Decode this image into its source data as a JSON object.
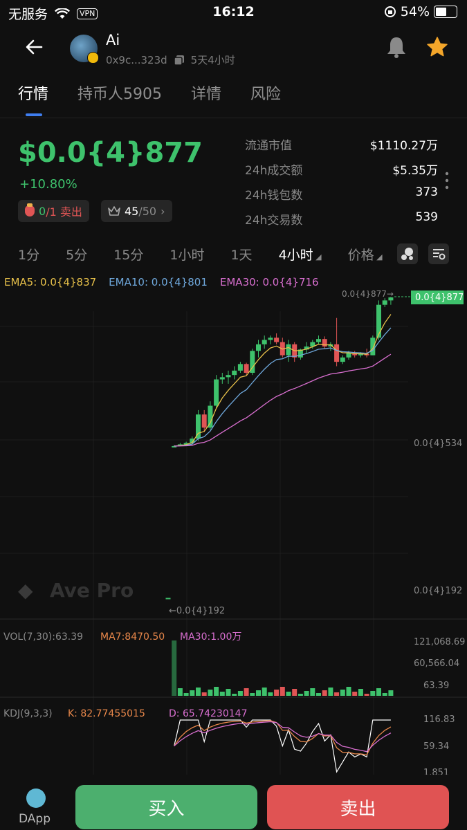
{
  "status_bar": {
    "carrier": "无服务",
    "vpn": "VPN",
    "time": "16:12",
    "battery": "54%"
  },
  "header": {
    "token_name": "Ai",
    "address": "0x9c...323d",
    "age": "5天4小时"
  },
  "tabs": [
    {
      "label": "行情",
      "active": true
    },
    {
      "label": "持币人5905",
      "active": false
    },
    {
      "label": "详情",
      "active": false
    },
    {
      "label": "风险",
      "active": false
    }
  ],
  "price": {
    "value": "$0.0{4}877",
    "change": "+10.80%",
    "tax_label": "0/1 卖出",
    "tax_prefix": "0",
    "tax_suffix": "/1 卖出",
    "score": "45",
    "score_total": "/50"
  },
  "stats": [
    {
      "label": "流通市值",
      "value": "$1110.27万"
    },
    {
      "label": "24h成交额",
      "value": "$5.35万"
    },
    {
      "label": "24h钱包数",
      "value": "373"
    },
    {
      "label": "24h交易数",
      "value": "539"
    }
  ],
  "timeframes": [
    {
      "label": "1分",
      "active": false
    },
    {
      "label": "5分",
      "active": false
    },
    {
      "label": "15分",
      "active": false
    },
    {
      "label": "1小时",
      "active": false
    },
    {
      "label": "1天",
      "active": false
    },
    {
      "label": "4小时",
      "active": true
    },
    {
      "label": "价格",
      "active": false
    }
  ],
  "ema": {
    "ema5": "EMA5: 0.0{4}837",
    "ema10": "EMA10: 0.0{4}801",
    "ema30": "EMA30: 0.0{4}716"
  },
  "chart_labels": {
    "current_price_tag": "0.0{4}877",
    "high_marker": "0.0{4}877→",
    "low_marker": "←0.0{4}192",
    "axis_mid": "0.0{4}534",
    "axis_low": "0.0{4}192",
    "watermark": "Ave Pro"
  },
  "volume": {
    "label": "VOL(7,30):63.39",
    "ma7": "MA7:8470.50",
    "ma30": "MA30:1.00万",
    "axis": [
      "121,068.69",
      "60,566.04",
      "63.39"
    ]
  },
  "kdj": {
    "label": "KDJ(9,3,3)",
    "k": "K: 82.77455015",
    "d": "D: 65.74230147",
    "axis": [
      "116.83",
      "59.34",
      "1.851"
    ]
  },
  "bottom": {
    "dapp": "DApp",
    "buy": "买入",
    "sell": "卖出"
  },
  "colors": {
    "up": "#3ec26c",
    "down": "#e05555",
    "ema5": "#e8c14a",
    "ema10": "#6fa8dc",
    "ema30": "#d96fd0"
  },
  "chart_data": {
    "type": "candlestick",
    "x_unit": "4h candle index",
    "ohlc": [
      [
        192,
        192,
        192,
        192
      ],
      [
        535,
        540,
        535,
        538
      ],
      [
        538,
        545,
        538,
        542
      ],
      [
        542,
        548,
        538,
        545
      ],
      [
        545,
        560,
        540,
        555
      ],
      [
        555,
        620,
        550,
        610
      ],
      [
        610,
        620,
        570,
        580
      ],
      [
        580,
        640,
        575,
        630
      ],
      [
        630,
        700,
        625,
        690
      ],
      [
        690,
        705,
        680,
        695
      ],
      [
        695,
        710,
        680,
        700
      ],
      [
        700,
        720,
        690,
        710
      ],
      [
        710,
        730,
        705,
        725
      ],
      [
        725,
        728,
        700,
        705
      ],
      [
        705,
        760,
        700,
        755
      ],
      [
        755,
        780,
        740,
        770
      ],
      [
        770,
        790,
        760,
        780
      ],
      [
        780,
        790,
        770,
        785
      ],
      [
        785,
        795,
        770,
        775
      ],
      [
        775,
        785,
        740,
        745
      ],
      [
        745,
        780,
        730,
        770
      ],
      [
        770,
        775,
        730,
        740
      ],
      [
        740,
        760,
        735,
        758
      ],
      [
        758,
        775,
        750,
        765
      ],
      [
        765,
        780,
        760,
        775
      ],
      [
        775,
        790,
        770,
        782
      ],
      [
        782,
        788,
        760,
        765
      ],
      [
        765,
        775,
        755,
        770
      ],
      [
        770,
        830,
        720,
        730
      ],
      [
        730,
        745,
        725,
        740
      ],
      [
        740,
        755,
        735,
        750
      ],
      [
        750,
        755,
        740,
        745
      ],
      [
        745,
        752,
        740,
        748
      ],
      [
        748,
        760,
        740,
        745
      ],
      [
        745,
        790,
        745,
        785
      ],
      [
        785,
        870,
        780,
        860
      ],
      [
        860,
        875,
        855,
        870
      ],
      [
        870,
        878,
        860,
        877
      ]
    ],
    "volume_max": 121068.69
  }
}
